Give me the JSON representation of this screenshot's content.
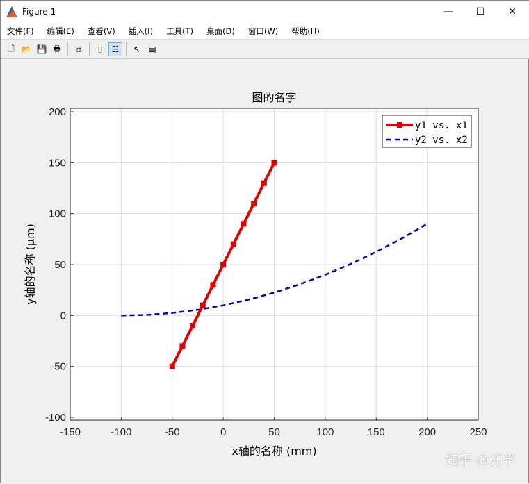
{
  "window": {
    "title": "Figure 1",
    "minimize": "—",
    "maximize": "☐",
    "close": "✕"
  },
  "menu": [
    "文件(F)",
    "编辑(E)",
    "查看(V)",
    "插入(I)",
    "工具(T)",
    "桌面(D)",
    "窗口(W)",
    "帮助(H)"
  ],
  "toolbar": [
    {
      "name": "new-figure-icon",
      "glyph": "🗋"
    },
    {
      "name": "open-icon",
      "glyph": "📂"
    },
    {
      "name": "save-icon",
      "glyph": "💾"
    },
    {
      "name": "print-icon",
      "glyph": "🖶"
    },
    {
      "name": "link-icon",
      "glyph": "⧉"
    },
    {
      "name": "colorbar-icon",
      "glyph": "▯"
    },
    {
      "name": "legend-icon",
      "glyph": "☷"
    },
    {
      "name": "pointer-icon",
      "glyph": "↖"
    },
    {
      "name": "property-inspector-icon",
      "glyph": "▤"
    }
  ],
  "watermark": "知乎 @光学",
  "chart_data": {
    "type": "line",
    "title": "图的名字",
    "xlabel": "x轴的名称 (mm)",
    "ylabel": "y轴的名称 (μm)",
    "xlim": [
      -150,
      250
    ],
    "ylim": [
      -102.7,
      203.4
    ],
    "xticks": [
      -150,
      -100,
      -50,
      0,
      50,
      100,
      150,
      200,
      250
    ],
    "yticks": [
      -100,
      -50,
      0,
      50,
      100,
      150,
      200
    ],
    "grid": true,
    "legend_position": "top-right",
    "series": [
      {
        "name": "y1 vs. x1",
        "color": "#e00000",
        "style": "solid-square-markers",
        "x": [
          -50,
          -40,
          -30,
          -20,
          -10,
          0,
          10,
          20,
          30,
          40,
          50
        ],
        "y": [
          -50,
          -30,
          -10,
          10,
          30,
          50,
          70,
          90,
          110,
          130,
          150
        ]
      },
      {
        "name": "y2 vs. x2",
        "color": "#0000c0",
        "style": "dashed",
        "x": [
          -100,
          -75,
          -50,
          -25,
          0,
          25,
          50,
          75,
          100,
          125,
          150,
          175,
          200
        ],
        "y": [
          0,
          0.625,
          2.5,
          5.625,
          10,
          15.625,
          22.5,
          30.625,
          40,
          50.625,
          62.5,
          75.625,
          90
        ]
      }
    ]
  }
}
